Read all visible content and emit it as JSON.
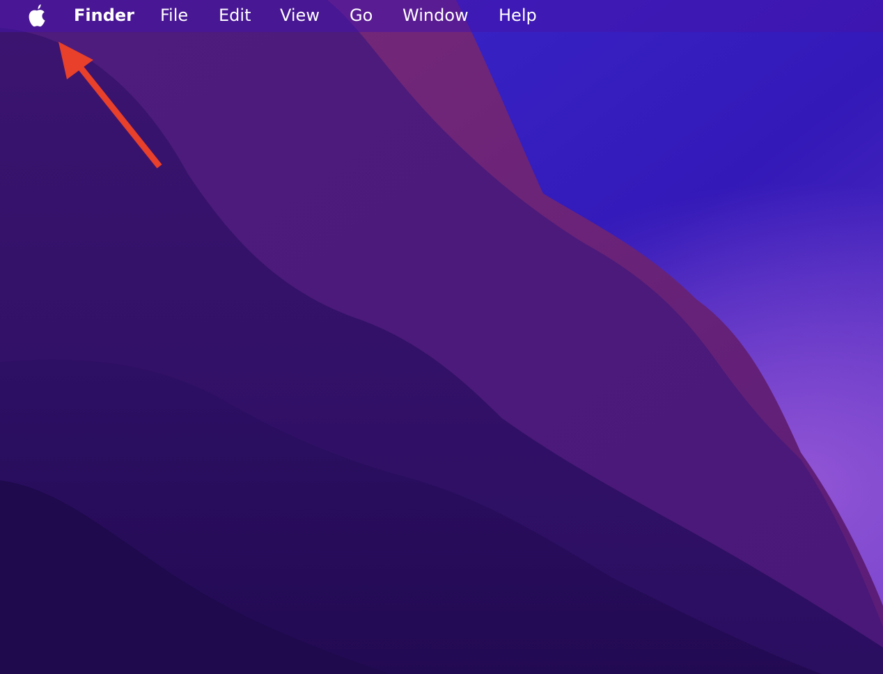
{
  "menubar": {
    "apple_icon": "apple-logo-icon",
    "app_name": "Finder",
    "items": [
      "File",
      "Edit",
      "View",
      "Go",
      "Window",
      "Help"
    ]
  },
  "colors": {
    "menu_text": "#ffffff",
    "annotation_arrow": "#e8402a",
    "wallpaper_deep": "#230c55",
    "wallpaper_violet": "#4d1a7e",
    "wallpaper_magenta": "#6e2573",
    "wallpaper_blue": "#3a22c8"
  },
  "annotation": {
    "type": "arrow",
    "points_to": "apple-menu"
  }
}
